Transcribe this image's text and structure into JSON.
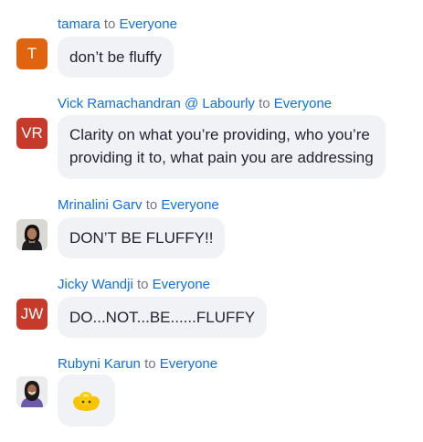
{
  "messages": [
    {
      "sender": "tamara",
      "to_word": "to",
      "recipient": "Everyone",
      "avatar_initials": "T",
      "avatar_color": "#e0630f",
      "text": "don’t be fluffy"
    },
    {
      "sender": "Vick Ramachandran @ Labourly",
      "to_word": "to",
      "recipient": "Everyone",
      "avatar_initials": "VR",
      "avatar_color": "#c53a2a",
      "text_lines": [
        "Clarity on what you’re providing, who you’re",
        "providing it to, what pain you are addressing"
      ]
    },
    {
      "sender": "Mrinalini Garv",
      "to_word": "to",
      "recipient": "Everyone",
      "avatar_icon": "profile-photo",
      "text": "DON’T BE FLUFFY!!"
    },
    {
      "sender": "Jicky Wandji",
      "to_word": "to",
      "recipient": "Everyone",
      "avatar_initials": "JW",
      "avatar_color": "#c53a2a",
      "text": "DO...NOT...BE......FLUFFY"
    },
    {
      "sender": "Rubyni Karun",
      "to_word": "to",
      "recipient": "Everyone",
      "avatar_icon": "profile-photo",
      "emoji_icon": "yellow-cloud-emoji"
    }
  ],
  "colors": {
    "link": "#0e71eb",
    "muted": "#747487",
    "bubble": "#f1f2f5",
    "text": "#232333"
  }
}
